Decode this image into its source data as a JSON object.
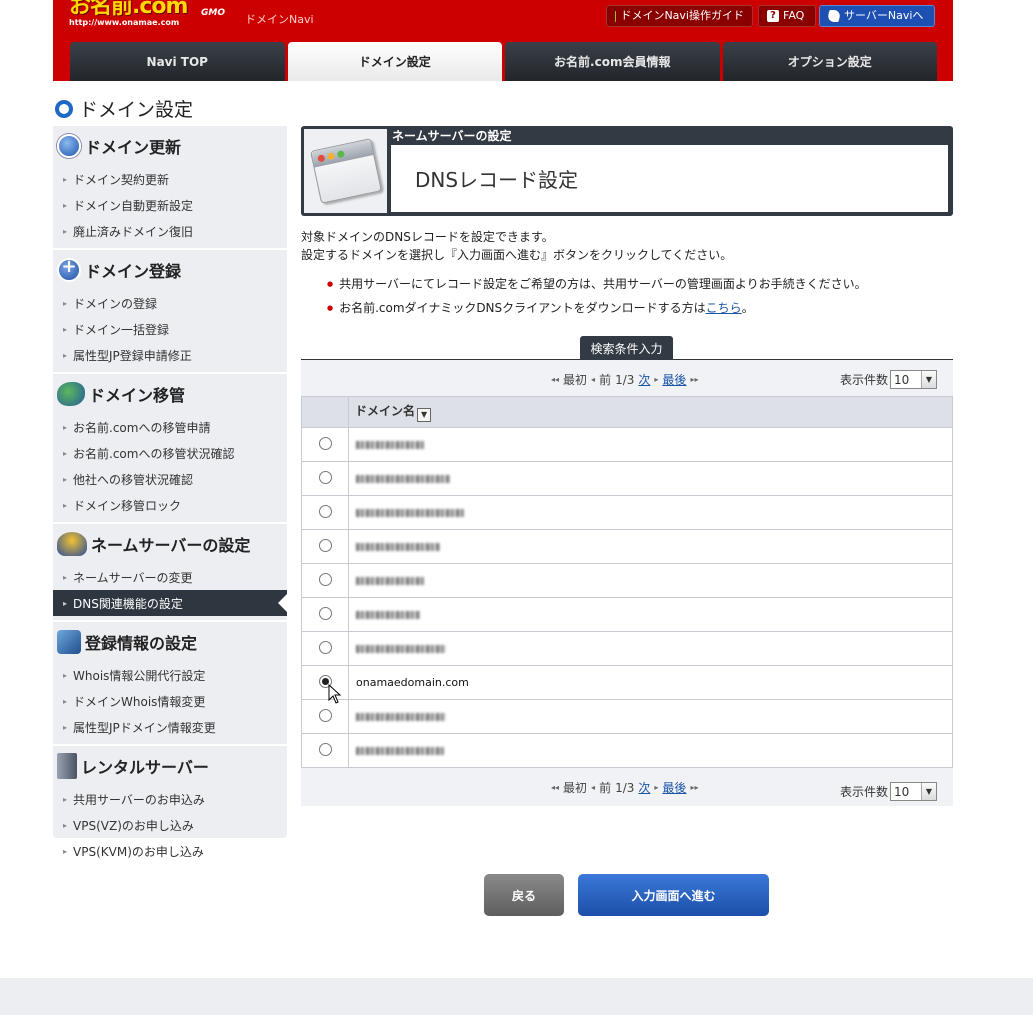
{
  "header": {
    "logo_brand": "お名前.com",
    "logo_url": "http://www.onamae.com",
    "logo_gmo": "GMO",
    "navi_name": "ドメインNavi",
    "guide_button": "ドメインNavi操作ガイド",
    "faq_button": "FAQ",
    "server_button": "サーバーNaviへ",
    "colors": {
      "brand_red": "#cc0000",
      "logo_yellow": "#ffd800",
      "server_blue": "#1e4fb3"
    }
  },
  "tabs": [
    {
      "label": "Navi TOP"
    },
    {
      "label": "ドメイン設定"
    },
    {
      "label": "お名前.com会員情報"
    },
    {
      "label": "オプション設定"
    }
  ],
  "page_title": "ドメイン設定",
  "sidebar": {
    "groups": [
      {
        "title": "ドメイン更新",
        "items": [
          "ドメイン契約更新",
          "ドメイン自動更新設定",
          "廃止済みドメイン復旧"
        ]
      },
      {
        "title": "ドメイン登録",
        "items": [
          "ドメインの登録",
          "ドメイン一括登録",
          "属性型JP登録申請修正"
        ]
      },
      {
        "title": "ドメイン移管",
        "items": [
          "お名前.comへの移管申請",
          "お名前.comへの移管状況確認",
          "他社への移管状況確認",
          "ドメイン移管ロック"
        ]
      },
      {
        "title": "ネームサーバーの設定",
        "items": [
          "ネームサーバーの変更",
          "DNS関連機能の設定"
        ]
      },
      {
        "title": "登録情報の設定",
        "items": [
          "Whois情報公開代行設定",
          "ドメインWhois情報変更",
          "属性型JPドメイン情報変更"
        ]
      },
      {
        "title": "レンタルサーバー",
        "items": [
          "共用サーバーのお申込み",
          "VPS(VZ)のお申し込み",
          "VPS(KVM)のお申し込み"
        ]
      }
    ]
  },
  "panel": {
    "subtitle": "ネームサーバーの設定",
    "title": "DNSレコード設定"
  },
  "description": {
    "line1": "対象ドメインのDNSレコードを設定できます。",
    "line2": "設定するドメインを選択し『入力画面へ進む』ボタンをクリックしてください。"
  },
  "notes": {
    "note1": "共用サーバーにてレコード設定をご希望の方は、共用サーバーの管理画面よりお手続きください。",
    "note2_prefix": "お名前.comダイナミックDNSクライアントをダウンロードする方は",
    "note2_link": "こちら",
    "note2_suffix": "。"
  },
  "search_tab": "検索条件入力",
  "pager": {
    "first": "最初",
    "prev": "前",
    "page": "1/3",
    "next": "次",
    "last": "最後",
    "per_page_label": "表示件数",
    "per_page_value": "10"
  },
  "table": {
    "header": "ドメイン名",
    "visible_row_name": "onamaedomain.com"
  },
  "buttons": {
    "back": "戻る",
    "next": "入力画面へ進む"
  }
}
